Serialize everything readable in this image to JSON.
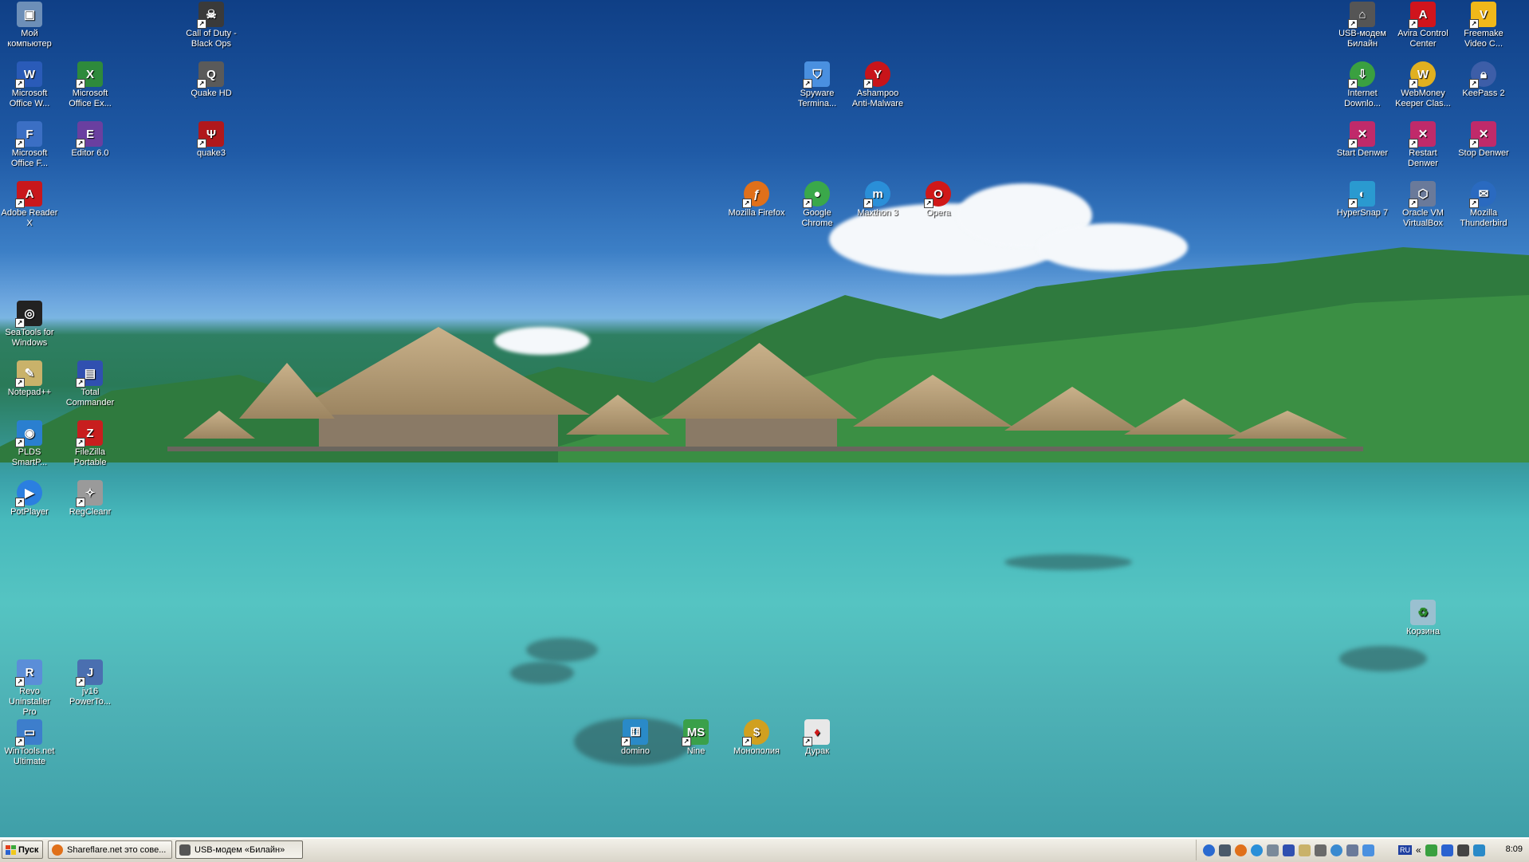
{
  "desktop": {
    "icons": [
      {
        "label": "Мой компьютер",
        "icon": "computer-icon",
        "color": "#6d8fb8"
      },
      {
        "label": "Call of Duty - Black Ops",
        "icon": "skull-icon",
        "color": "#3a3a3a"
      },
      {
        "label": "Microsoft Office W...",
        "icon": "word-icon",
        "color": "#2a5bb8"
      },
      {
        "label": "Microsoft Office Ex...",
        "icon": "excel-icon",
        "color": "#2e8a3c"
      },
      {
        "label": "Quake HD",
        "icon": "quake-icon",
        "color": "#5a5a5a"
      },
      {
        "label": "Microsoft Office F...",
        "icon": "frontpage-icon",
        "color": "#3b6fc4"
      },
      {
        "label": "Editor 6.0",
        "icon": "editor-icon",
        "color": "#6a3fa0"
      },
      {
        "label": "quake3",
        "icon": "quake3-icon",
        "color": "#b0181c"
      },
      {
        "label": "Adobe Reader X",
        "icon": "pdf-icon",
        "color": "#c8171c"
      },
      {
        "label": "SeaTools for Windows",
        "icon": "seatools-icon",
        "color": "#222222"
      },
      {
        "label": "Notepad++",
        "icon": "notepad-icon",
        "color": "#c9b26a"
      },
      {
        "label": "Total Commander",
        "icon": "floppy-icon",
        "color": "#3050b0"
      },
      {
        "label": "PLDS SmartP...",
        "icon": "disc-icon",
        "color": "#2a7fd0"
      },
      {
        "label": "FileZilla Portable",
        "icon": "filezilla-icon",
        "color": "#c81e1e"
      },
      {
        "label": "PotPlayer",
        "icon": "player-icon",
        "color": "#2b7fe0"
      },
      {
        "label": "RegCleanr",
        "icon": "cleaner-icon",
        "color": "#9a9a9a"
      },
      {
        "label": "Revo Uninstaller Pro",
        "icon": "uninstall-icon",
        "color": "#5b8ed8"
      },
      {
        "label": "jv16 PowerTo...",
        "icon": "tools-icon",
        "color": "#4a6fb0"
      },
      {
        "label": "WinTools.net Ultimate",
        "icon": "monitor-icon",
        "color": "#3d7ecc"
      },
      {
        "label": "Spyware Termina...",
        "icon": "shield-icon",
        "color": "#4a90e0"
      },
      {
        "label": "Ashampoo Anti-Malware",
        "icon": "antimalware-icon",
        "color": "#c8141a"
      },
      {
        "label": "Mozilla Firefox",
        "icon": "firefox-icon",
        "color": "#e0701a"
      },
      {
        "label": "Google Chrome",
        "icon": "chrome-icon",
        "color": "#3aa84a"
      },
      {
        "label": "Maxthon 3",
        "icon": "maxthon-icon",
        "color": "#2a8fd8"
      },
      {
        "label": "Opera",
        "icon": "opera-icon",
        "color": "#d01818"
      },
      {
        "label": "USB-модем Билайн",
        "icon": "modem-icon",
        "color": "#555555"
      },
      {
        "label": "Avira Control Center",
        "icon": "avira-icon",
        "color": "#d0141c"
      },
      {
        "label": "Freemake Video C...",
        "icon": "freemake-icon",
        "color": "#f0b81a"
      },
      {
        "label": "Internet Downlo...",
        "icon": "download-icon",
        "color": "#3aa040"
      },
      {
        "label": "WebMoney Keeper Clas...",
        "icon": "webmoney-icon",
        "color": "#e0b020"
      },
      {
        "label": "KeePass 2",
        "icon": "lock-icon",
        "color": "#3d5ea8"
      },
      {
        "label": "Start Denwer",
        "icon": "denwer-start-icon",
        "color": "#c02a6a"
      },
      {
        "label": "Restart Denwer",
        "icon": "denwer-restart-icon",
        "color": "#c02a6a"
      },
      {
        "label": "Stop Denwer",
        "icon": "denwer-stop-icon",
        "color": "#c02a6a"
      },
      {
        "label": "HyperSnap 7",
        "icon": "camera-icon",
        "color": "#2a9ad0"
      },
      {
        "label": "Oracle VM VirtualBox",
        "icon": "virtualbox-icon",
        "color": "#6a7a9a"
      },
      {
        "label": "Mozilla Thunderbird",
        "icon": "thunderbird-icon",
        "color": "#2a6ac0"
      },
      {
        "label": "Корзина",
        "icon": "recycle-bin-icon",
        "color": "#9ac0d0"
      },
      {
        "label": "domino",
        "icon": "domino-icon",
        "color": "#2a8ac8"
      },
      {
        "label": "Nine",
        "icon": "cards-icon",
        "color": "#3aa04a"
      },
      {
        "label": "Монополия",
        "icon": "coins-icon",
        "color": "#d0a020"
      },
      {
        "label": "Дурак",
        "icon": "playing-card-icon",
        "color": "#e8e8e8"
      }
    ]
  },
  "taskbar": {
    "start_label": "Пуск",
    "tasks": [
      {
        "label": "Shareflare.net это сове...",
        "icon": "firefox-icon",
        "active": false
      },
      {
        "label": "USB-модем «Билайн»",
        "icon": "modem-icon",
        "active": true
      }
    ],
    "tray": {
      "language": "RU",
      "clock": "8:09",
      "icons": [
        "ie-icon",
        "network-icon",
        "firefox-icon",
        "maxthon-icon",
        "settings-icon",
        "floppy-icon",
        "notepad-icon",
        "printer-icon",
        "globe-icon",
        "virtualbox-icon",
        "usb-icon"
      ]
    },
    "colors": {
      "flag_red": "#e2401c",
      "flag_green": "#3aa83a",
      "flag_blue": "#2a62d0",
      "flag_yellow": "#f0c81c"
    }
  }
}
